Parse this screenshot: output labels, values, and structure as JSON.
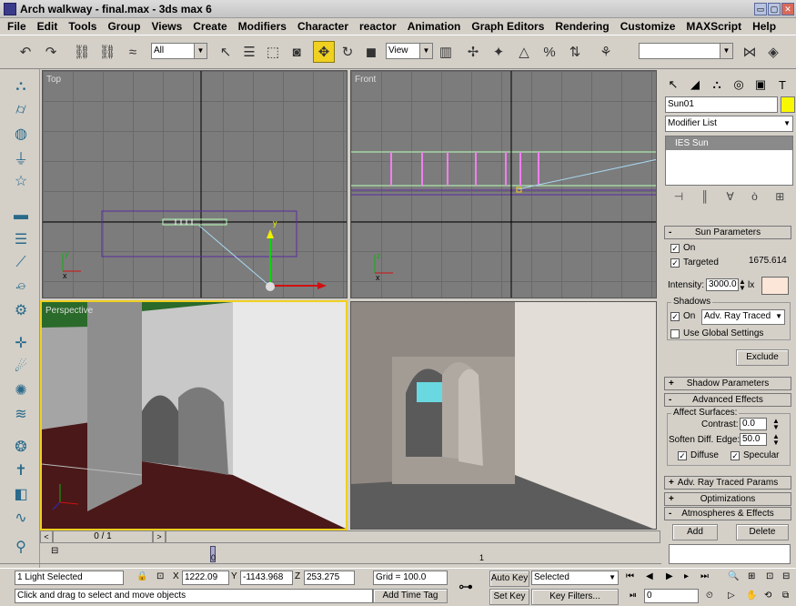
{
  "window": {
    "title": "Arch walkway - final.max - 3ds max 6",
    "buttons": [
      "▭",
      "▢",
      "✕"
    ]
  },
  "menu": [
    "File",
    "Edit",
    "Tools",
    "Group",
    "Views",
    "Create",
    "Modifiers",
    "Character",
    "reactor",
    "Animation",
    "Graph Editors",
    "Rendering",
    "Customize",
    "MAXScript",
    "Help"
  ],
  "toolbar": {
    "selection_filter": "All",
    "ref_coord": "View",
    "named_selection": ""
  },
  "viewports": {
    "top": "Top",
    "front": "Front",
    "perspective": "Perspective"
  },
  "command_panel": {
    "object_name": "Sun01",
    "object_color": "#f8f800",
    "modifier_list": "Modifier List",
    "stack_item": "IES Sun",
    "sun_parameters": {
      "header": "Sun Parameters",
      "on_label": "On",
      "targeted_label": "Targeted",
      "target_distance": "1675.614",
      "intensity_label": "Intensity:",
      "intensity_value": "3000.0",
      "intensity_unit": "lx",
      "light_color": "#fbe6d8",
      "shadows_label": "Shadows",
      "shadows_on_label": "On",
      "shadow_type": "Adv. Ray Traced",
      "global_settings_label": "Use Global Settings",
      "exclude_label": "Exclude"
    },
    "shadow_parameters": "Shadow Parameters",
    "advanced_effects": {
      "header": "Advanced Effects",
      "affect_surfaces": "Affect Surfaces:",
      "contrast_label": "Contrast:",
      "contrast_value": "0.0",
      "soften_label": "Soften Diff. Edge:",
      "soften_value": "50.0",
      "diffuse_label": "Diffuse",
      "specular_label": "Specular"
    },
    "adv_raytraced": "Adv. Ray Traced Params",
    "optimizations": "Optimizations",
    "atmospheres": {
      "header": "Atmospheres & Effects",
      "add": "Add",
      "delete": "Delete"
    }
  },
  "timeline": {
    "frame": "0 / 1",
    "frame_marker": "0",
    "end_marker": "1"
  },
  "status": {
    "selection": "1 Light Selected",
    "prompt": "Click and drag to select and move objects",
    "x_label": "X",
    "x_value": "1222.09",
    "y_label": "Y",
    "y_value": "-1143.968",
    "z_label": "Z",
    "z_value": "253.275",
    "grid": "Grid = 100.0",
    "add_time_tag": "Add Time Tag",
    "auto_key": "Auto Key",
    "set_key": "Set Key",
    "key_mode": "Selected",
    "key_filters": "Key Filters...",
    "current_frame": "0"
  }
}
